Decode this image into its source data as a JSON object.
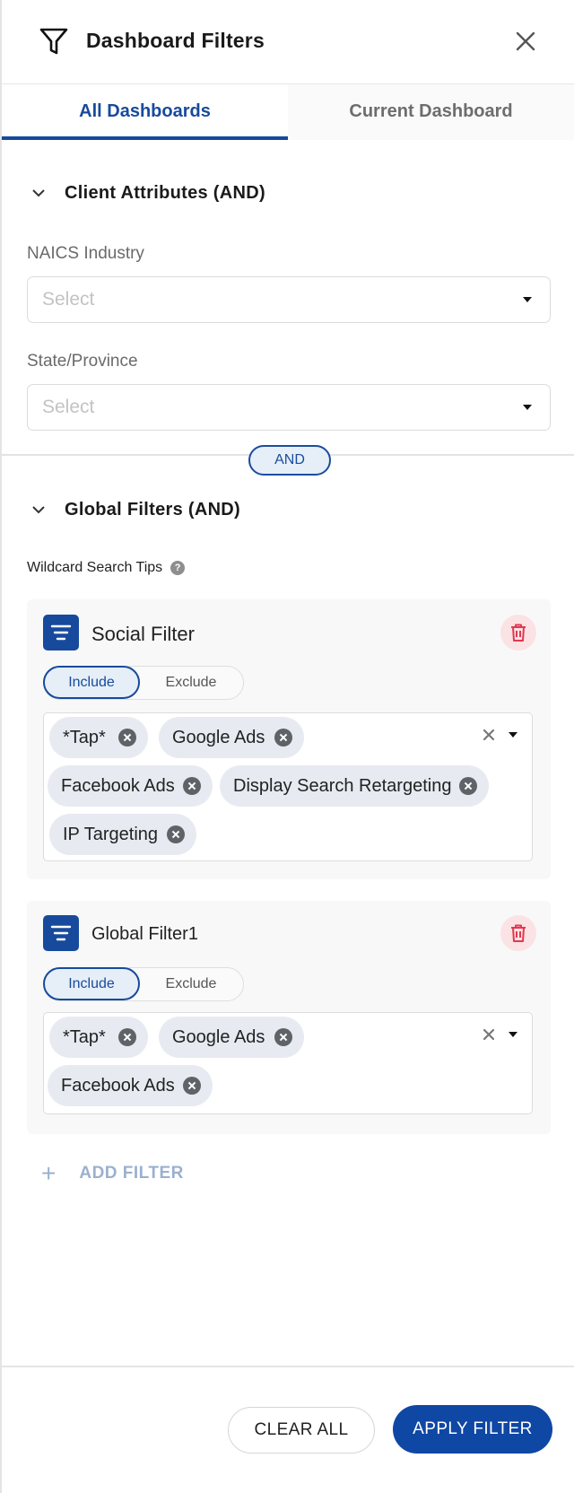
{
  "header": {
    "title": "Dashboard  Filters",
    "icon": "filter-funnel-icon",
    "close_icon": "close-icon"
  },
  "tabs": [
    {
      "label": "All Dashboards",
      "active": true
    },
    {
      "label": "Current Dashboard",
      "active": false
    }
  ],
  "client_attributes": {
    "title": "Client Attributes (AND)",
    "fields": [
      {
        "label": "NAICS Industry",
        "placeholder": "Select"
      },
      {
        "label": "State/Province",
        "placeholder": "Select"
      }
    ]
  },
  "connector": {
    "label": "AND"
  },
  "global_filters": {
    "title": "Global Filters (AND)",
    "tips": "Wildcard Search Tips",
    "cards": [
      {
        "title": "Social Filter",
        "include_label": "Include",
        "exclude_label": "Exclude",
        "mode": "Include",
        "chips": [
          "*Tap*",
          "Google Ads",
          "Facebook Ads",
          "Display Search Retargeting",
          "IP Targeting"
        ]
      },
      {
        "title": "Global Filter1",
        "include_label": "Include",
        "exclude_label": "Exclude",
        "mode": "Include",
        "chips": [
          "*Tap*",
          "Google Ads",
          "Facebook Ads"
        ]
      }
    ]
  },
  "add_filter": {
    "label": "ADD FILTER"
  },
  "footer": {
    "clear_label": "CLEAR ALL",
    "apply_label": "APPLY FILTER"
  },
  "colors": {
    "primary": "#174a9c",
    "danger": "#e2394f",
    "chip_bg": "#e7ebf1"
  }
}
